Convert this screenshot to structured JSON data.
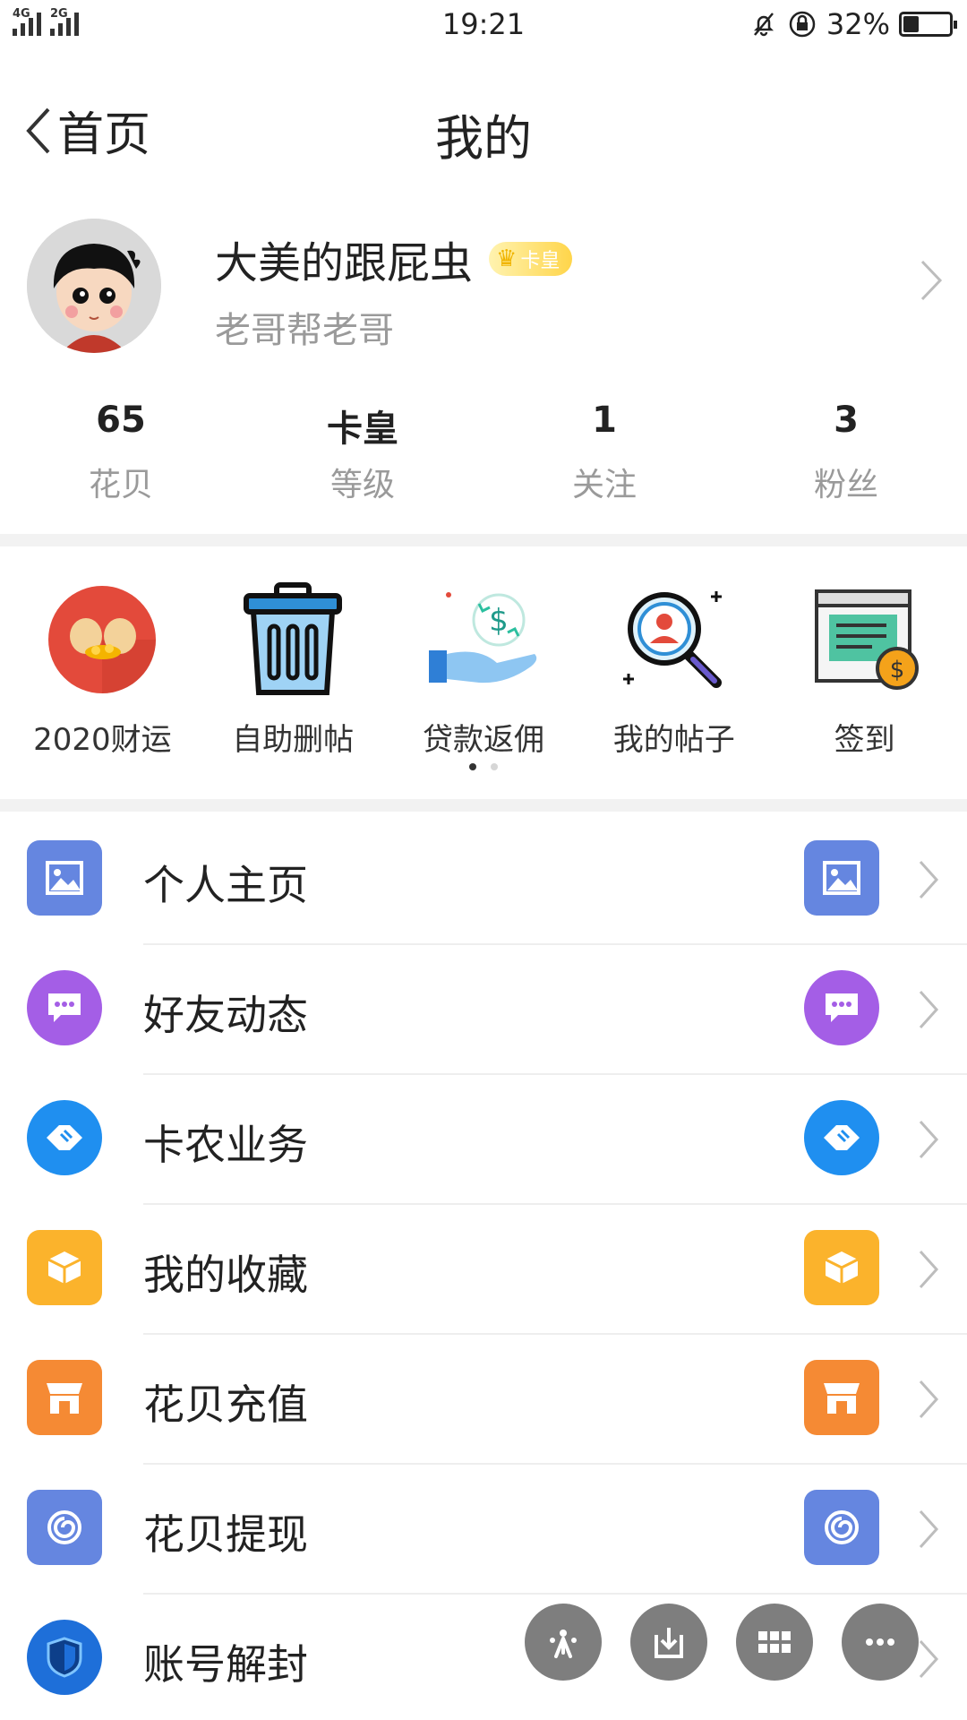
{
  "status_bar": {
    "time": "19:21",
    "network_1": "4G",
    "network_2": "2G",
    "battery_text": "32%",
    "battery_level": 0.32
  },
  "nav": {
    "back_label": "首页",
    "title": "我的"
  },
  "profile": {
    "username": "大美的跟屁虫",
    "badge": "卡皇",
    "signature": "老哥帮老哥"
  },
  "stats": [
    {
      "value": "65",
      "label": "花贝"
    },
    {
      "value": "卡皇",
      "label": "等级"
    },
    {
      "value": "1",
      "label": "关注"
    },
    {
      "value": "3",
      "label": "粉丝"
    }
  ],
  "quick_menu": [
    {
      "label": "2020财运",
      "icon": "fortune-icon"
    },
    {
      "label": "自助删帖",
      "icon": "trash-icon"
    },
    {
      "label": "贷款返佣",
      "icon": "cash-hand-icon"
    },
    {
      "label": "我的帖子",
      "icon": "search-person-icon"
    },
    {
      "label": "签到",
      "icon": "checkin-icon"
    }
  ],
  "pager": {
    "current": 1,
    "total": 2
  },
  "menu": [
    {
      "label": "个人主页",
      "icon": "image-icon",
      "color": "#6586e0"
    },
    {
      "label": "好友动态",
      "icon": "chat-icon",
      "color": "#a45ee6"
    },
    {
      "label": "卡农业务",
      "icon": "handshake-icon",
      "color": "#1f8ff0"
    },
    {
      "label": "我的收藏",
      "icon": "box-icon",
      "color": "#fbb32c"
    },
    {
      "label": "花贝充值",
      "icon": "store-icon",
      "color": "#f58a34"
    },
    {
      "label": "花贝提现",
      "icon": "spiral-icon",
      "color": "#6586e0"
    },
    {
      "label": "账号解封",
      "icon": "shield-icon",
      "color": "#1e6fd9"
    }
  ],
  "floating_toolbar": [
    "sparkle-icon",
    "download-icon",
    "grid-icon",
    "more-icon"
  ]
}
